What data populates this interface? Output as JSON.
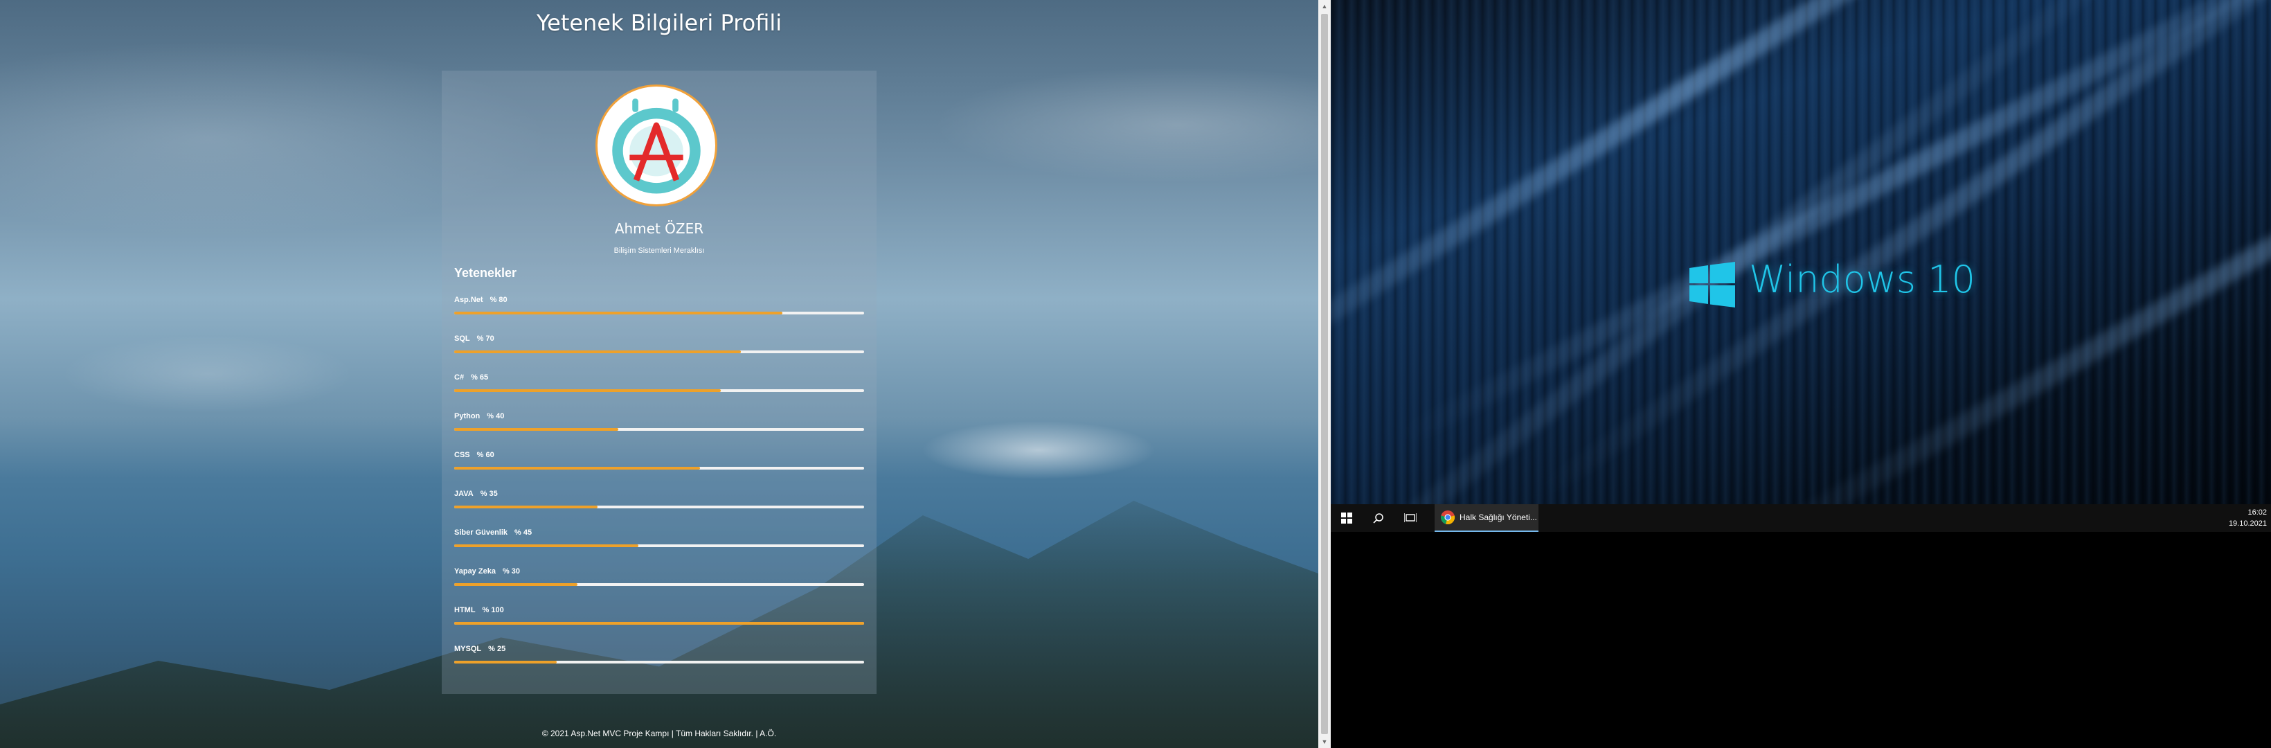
{
  "browser": {
    "title": "Yetenek Bilgileri Profili",
    "profile": {
      "name": "Ahmet ÖZER",
      "subtitle": "Bilişim Sistemleri Meraklısı",
      "skills_heading": "Yetenekler",
      "skills": [
        {
          "name": "Asp.Net",
          "percent_label": "% 80",
          "level": 80
        },
        {
          "name": "SQL",
          "percent_label": "% 70",
          "level": 70
        },
        {
          "name": "C#",
          "percent_label": "% 65",
          "level": 65
        },
        {
          "name": "Python",
          "percent_label": "% 40",
          "level": 40
        },
        {
          "name": "CSS",
          "percent_label": "% 60",
          "level": 60
        },
        {
          "name": "JAVA",
          "percent_label": "% 35",
          "level": 35
        },
        {
          "name": "Siber Güvenlik",
          "percent_label": "% 45",
          "level": 45
        },
        {
          "name": "Yapay Zeka",
          "percent_label": "% 30",
          "level": 30
        },
        {
          "name": "HTML",
          "percent_label": "% 100",
          "level": 100
        },
        {
          "name": "MYSQL",
          "percent_label": "% 25",
          "level": 25
        }
      ]
    },
    "footer": "© 2021 Asp.Net MVC Proje Kampı | Tüm Hakları Saklıdır. | A.Ö.",
    "colors": {
      "bar_fill": "#eea12a",
      "bar_track": "#f2f2f2",
      "avatar_border": "#f0a13a"
    }
  },
  "desktop": {
    "wallpaper_text": "Windows 10",
    "taskbar": {
      "start_icon": "windows-start-icon",
      "search_icon": "search-icon",
      "task_view_icon": "task-view-icon",
      "app": {
        "icon": "chrome-icon",
        "label": "Halk Sağlığı Yöneti..."
      },
      "clock": {
        "time": "16:02",
        "date": "19.10.2021"
      }
    },
    "colors": {
      "accent": "#20c5e8",
      "taskbar": "#101010"
    }
  }
}
